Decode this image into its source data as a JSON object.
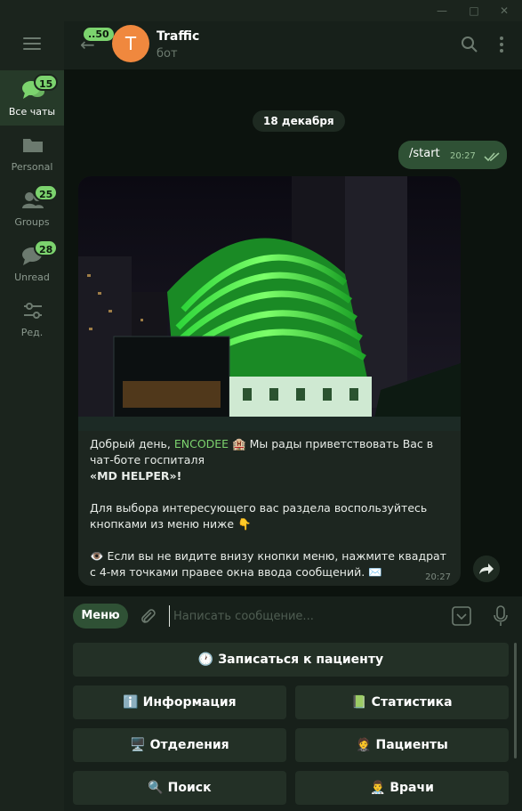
{
  "window": {
    "controls": [
      "minimize",
      "maximize",
      "close"
    ]
  },
  "sidebar": {
    "folders": [
      {
        "label": "Все чаты",
        "badge": "15",
        "icon": "chats-icon",
        "active": true
      },
      {
        "label": "Personal",
        "badge": "",
        "icon": "folder-icon"
      },
      {
        "label": "Groups",
        "badge": "25",
        "icon": "groups-icon"
      },
      {
        "label": "Unread",
        "badge": "28",
        "icon": "unread-icon"
      },
      {
        "label": "Ред.",
        "badge": "",
        "icon": "edit-filters-icon"
      }
    ]
  },
  "header": {
    "back_count": "..50",
    "avatar_letter": "T",
    "title": "Traffic",
    "subtitle": "бот"
  },
  "chat": {
    "date": "18 декабря",
    "outgoing": {
      "text": "/start",
      "time": "20:27"
    },
    "incoming": {
      "greeting_pre": "Добрый день, ",
      "user_name": "ENCODEE",
      "greeting_post": " 🏨 Мы рады приветствовать Вас в чат-боте госпиталя",
      "hospital": "«MD HELPER»!",
      "paragraph2": "Для выбора интересующего вас раздела воспользуйтесь кнопками из меню ниже 👇",
      "paragraph3": "👁️ Если вы не видите внизу кнопки меню, нажмите квадрат с 4-мя точками правее окна ввода сообщений. ✉️",
      "time": "20:27"
    }
  },
  "composer": {
    "menu_label": "Меню",
    "placeholder": "Написать сообщение..."
  },
  "keyboard": {
    "rows": [
      [
        "🕐 Записаться к пациенту"
      ],
      [
        "ℹ️ Информация",
        "📗 Статистика"
      ],
      [
        "🖥️ Отделения",
        "🤵 Пациенты"
      ],
      [
        "🔍 Поиск",
        "👨‍⚕️ Врачи"
      ]
    ]
  },
  "colors": {
    "accent": "#7cd36e",
    "bubble_out": "#2f5135",
    "background": "#0c130e"
  }
}
